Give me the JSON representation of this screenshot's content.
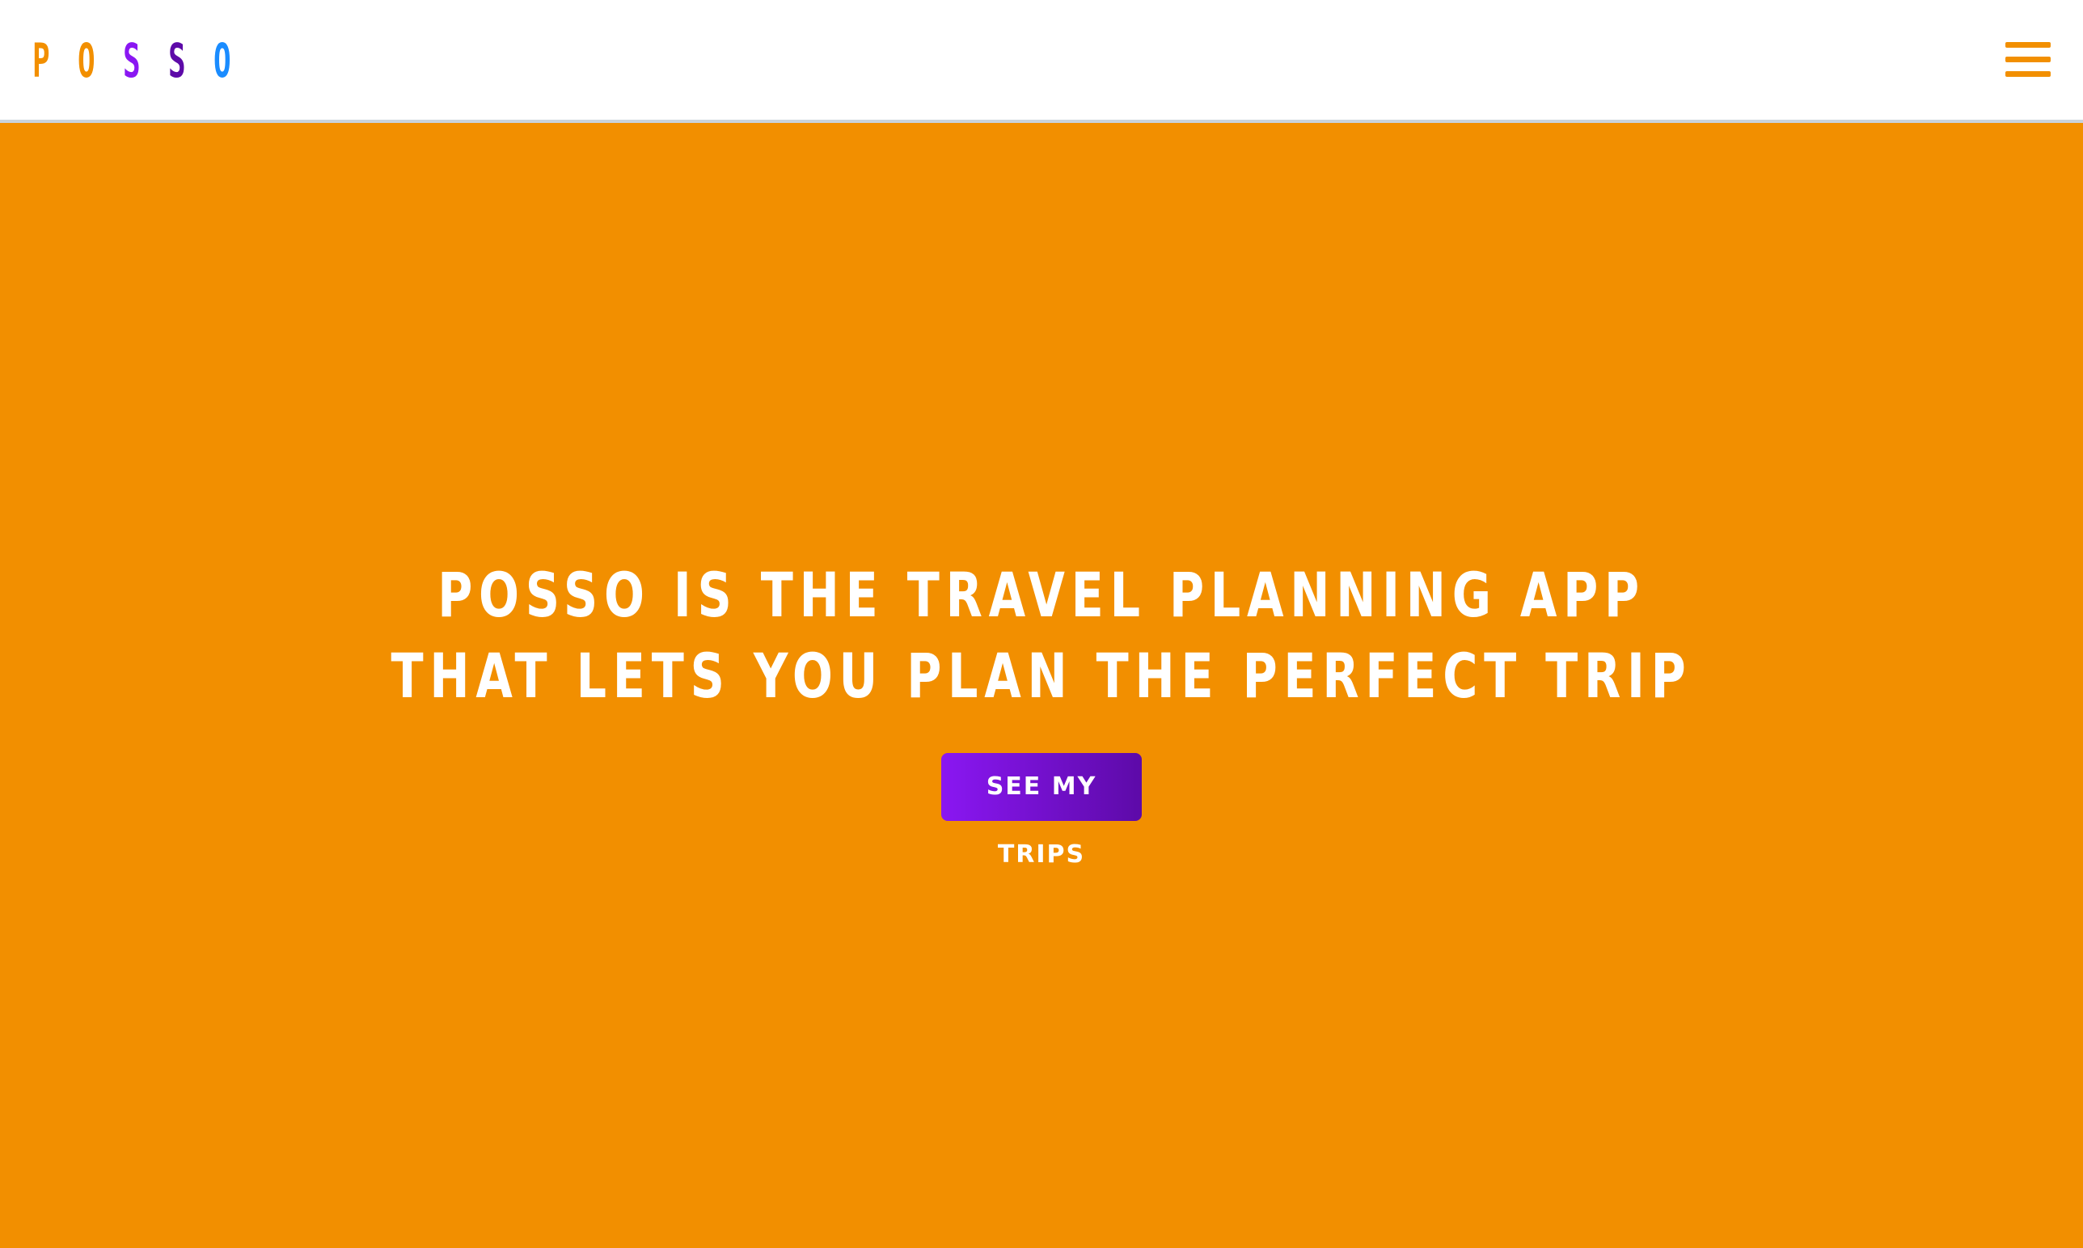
{
  "header": {
    "logo": {
      "letters": [
        {
          "char": "P",
          "color": "#f28f00"
        },
        {
          "char": "O",
          "color": "#f28f00"
        },
        {
          "char": "S",
          "color": "#8a17f2"
        },
        {
          "char": "S",
          "color": "#5d0aa8"
        },
        {
          "char": "O",
          "color": "#1a8cff"
        }
      ]
    },
    "menu_icon": "hamburger-menu-icon"
  },
  "hero": {
    "headline_line1": "POSSO IS THE TRAVEL PLANNING APP",
    "headline_line2": "THAT LETS YOU PLAN THE PERFECT TRIP",
    "cta_label": "SEE MY TRIPS"
  },
  "colors": {
    "brand_orange": "#f28f00",
    "brand_purple": "#8a17f2",
    "brand_deep_purple": "#5d0aa8",
    "brand_blue": "#1a8cff",
    "header_border": "#c9d3dc"
  }
}
